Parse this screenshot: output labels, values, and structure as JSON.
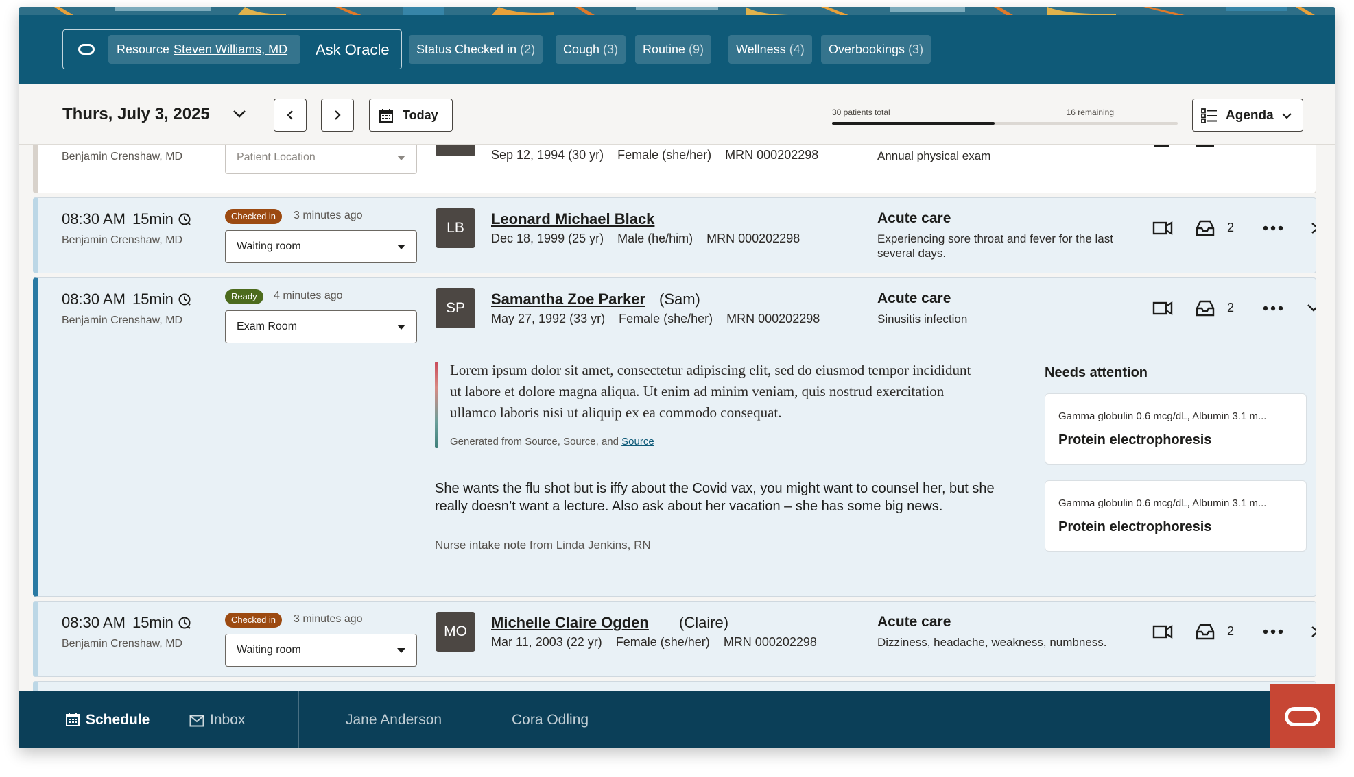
{
  "header": {
    "resource_label": "Resource",
    "resource_name": "Steven Williams, MD",
    "ask_oracle": "Ask Oracle",
    "filters": [
      {
        "label": "Status Checked in",
        "count": "(2)"
      },
      {
        "label": "Cough",
        "count": "(3)"
      },
      {
        "label": "Routine",
        "count": "(9)"
      },
      {
        "label": "Wellness",
        "count": "(4)"
      },
      {
        "label": "Overbookings",
        "count": "(3)"
      }
    ]
  },
  "toolbar": {
    "date": "Thurs, July 3, 2025",
    "today_label": "Today",
    "progress_total_label": "30 patients total",
    "progress_remaining_label": "16 remaining",
    "progress_fraction": 0.47,
    "view_label": "Agenda"
  },
  "appointments": [
    {
      "provider": "Benjamin Crenshaw, MD",
      "location_placeholder": "Patient Location",
      "dob": "Sep 12, 1994 (30 yr)",
      "sex": "Female (she/her)",
      "mrn": "MRN 000202298",
      "visit_reason": "Annual physical exam"
    },
    {
      "time": "08:30 AM",
      "duration": "15min",
      "provider": "Benjamin Crenshaw, MD",
      "status": "Checked in",
      "status_time": "3 minutes ago",
      "location": "Waiting room",
      "initials": "LB",
      "name": "Leonard Michael Black",
      "dob": "Dec 18, 1999 (25 yr)",
      "sex": "Male (he/him)",
      "mrn": "MRN 000202298",
      "visit_type": "Acute care",
      "visit_reason": "Experiencing sore throat and fever for the last several days.",
      "messages": "2"
    },
    {
      "time": "08:30 AM",
      "duration": "15min",
      "provider": "Benjamin Crenshaw, MD",
      "status": "Ready",
      "status_time": "4 minutes ago",
      "location": "Exam Room",
      "initials": "SP",
      "name": "Samantha Zoe Parker",
      "nickname": "(Sam)",
      "dob": "May 27, 1992 (33 yr)",
      "sex": "Female (she/her)",
      "mrn": "MRN 000202298",
      "visit_type": "Acute care",
      "visit_reason": "Sinusitis infection",
      "messages": "2",
      "summary": "Lorem ipsum dolor sit amet, consectetur adipiscing elit, sed do eiusmod tempor incididunt ut labore et dolore magna aliqua. Ut enim ad minim veniam, quis nostrud exercitation ullamco laboris nisi ut aliquip ex ea commodo consequat.",
      "summary_source_prefix": "Generated from Source, Source, and ",
      "summary_source_link": "Source",
      "nurse_note": "She wants the flu shot but is iffy about the Covid vax, you might want to counsel her, but she really doesn’t want a lecture. Also ask about her vacation – she has some big news.",
      "nurse_meta_prefix": "Nurse ",
      "nurse_meta_link": "intake note",
      "nurse_meta_suffix": " from Linda Jenkins, RN",
      "needs_attention_title": "Needs attention",
      "needs_attention": [
        {
          "detail": "Gamma globulin 0.6 mcg/dL, Albumin 3.1 m...",
          "title": "Protein electrophoresis"
        },
        {
          "detail": "Gamma globulin 0.6 mcg/dL, Albumin 3.1 m...",
          "title": "Protein electrophoresis"
        }
      ]
    },
    {
      "time": "08:30 AM",
      "duration": "15min",
      "provider": "Benjamin Crenshaw, MD",
      "status": "Checked in",
      "status_time": "3 minutes ago",
      "location": "Waiting room",
      "initials": "MO",
      "name": "Michelle Claire Ogden",
      "nickname": "(Claire)",
      "dob": "Mar 11, 2003 (22 yr)",
      "sex": "Female (she/her)",
      "mrn": "MRN 000202298",
      "visit_type": "Acute care",
      "visit_reason": "Dizziness, headache, weakness, numbness.",
      "messages": "2"
    }
  ],
  "bottom_nav": {
    "schedule": "Schedule",
    "inbox": "Inbox",
    "patient_tab_1": "Jane Anderson",
    "patient_tab_2": "Cora Odling"
  },
  "colors": {
    "header_bg": "#0f5a78",
    "bottom_nav_bg": "#0b3f58",
    "checked_in_badge": "#9c4a11",
    "ready_badge": "#4c6b1d",
    "oracle_red": "#c74634",
    "row_bg": "#e9f1f6",
    "expanded_border": "#2a7aa3"
  }
}
